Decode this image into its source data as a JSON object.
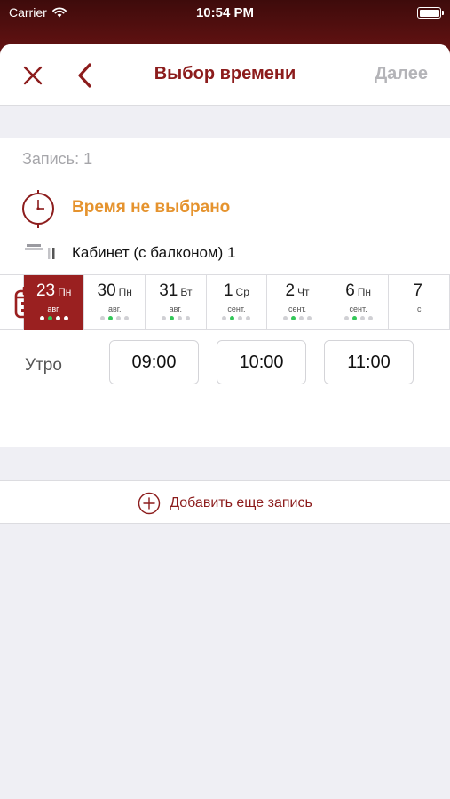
{
  "status_bar": {
    "carrier": "Carrier",
    "time": "10:54 PM"
  },
  "navbar": {
    "title": "Выбор времени",
    "next_label": "Далее"
  },
  "record": {
    "label": "Запись: 1",
    "time_status": "Время не выбрано",
    "room": "Кабинет (с балконом) 1"
  },
  "dates": [
    {
      "num": "23",
      "weekday": "Пн",
      "month": "авг.",
      "active": true,
      "dots": [
        "grey",
        "green",
        "grey",
        "grey"
      ]
    },
    {
      "num": "30",
      "weekday": "Пн",
      "month": "авг.",
      "active": false,
      "dots": [
        "grey",
        "green",
        "grey",
        "grey"
      ]
    },
    {
      "num": "31",
      "weekday": "Вт",
      "month": "авг.",
      "active": false,
      "dots": [
        "grey",
        "green",
        "grey",
        "grey"
      ]
    },
    {
      "num": "1",
      "weekday": "Ср",
      "month": "сент.",
      "active": false,
      "dots": [
        "grey",
        "green",
        "grey",
        "grey"
      ]
    },
    {
      "num": "2",
      "weekday": "Чт",
      "month": "сент.",
      "active": false,
      "dots": [
        "grey",
        "green",
        "grey",
        "grey"
      ]
    },
    {
      "num": "6",
      "weekday": "Пн",
      "month": "сент.",
      "active": false,
      "dots": [
        "grey",
        "green",
        "grey",
        "grey"
      ]
    },
    {
      "num": "7",
      "weekday": "",
      "month": "с",
      "active": false,
      "dots": []
    }
  ],
  "schedule": {
    "period": "Утро",
    "slots": [
      "09:00",
      "10:00",
      "11:00"
    ]
  },
  "add_record": {
    "label": "Добавить еще запись"
  },
  "colors": {
    "brand": "#8c1c1c",
    "active_day": "#9a2020",
    "warning": "#e5932e",
    "available_dot": "#34c759"
  },
  "icons": [
    "wifi-icon",
    "battery-icon",
    "close-icon",
    "back-chevron-icon",
    "clock-icon",
    "room-icon",
    "calendar-icon",
    "plus-circle-icon"
  ]
}
